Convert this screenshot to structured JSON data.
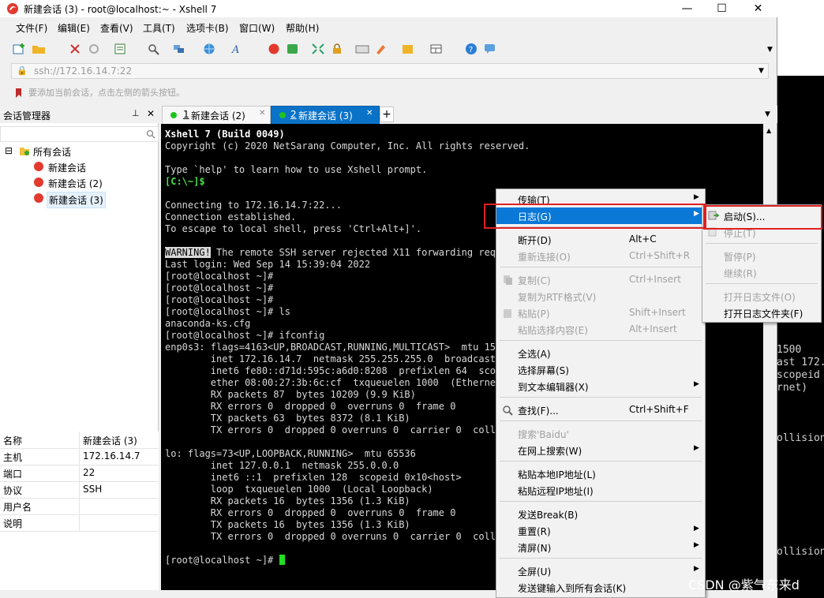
{
  "window": {
    "title": "新建会话 (3) - root@localhost:~ - Xshell 7",
    "controls": [
      "—",
      "☐",
      "✕"
    ]
  },
  "menu": [
    "文件(F)",
    "编辑(E)",
    "查看(V)",
    "工具(T)",
    "选项卡(B)",
    "窗口(W)",
    "帮助(H)"
  ],
  "address": {
    "value": "ssh://172.16.14.7:22"
  },
  "hint": "要添加当前会话，点击左侧的箭头按钮。",
  "session_manager": {
    "title": "会话管理器",
    "pin": "ᵖ",
    "close": "✕",
    "tree": {
      "root": "所有会话",
      "items": [
        "新建会话",
        "新建会话 (2)",
        "新建会话 (3)"
      ]
    },
    "properties": [
      {
        "key": "名称",
        "value": "新建会话 (3)"
      },
      {
        "key": "主机",
        "value": "172.16.14.7"
      },
      {
        "key": "端口",
        "value": "22"
      },
      {
        "key": "协议",
        "value": "SSH"
      },
      {
        "key": "用户名",
        "value": ""
      },
      {
        "key": "说明",
        "value": ""
      }
    ]
  },
  "tabs": [
    {
      "num": "1",
      "label": "新建会话 (2)"
    },
    {
      "num": "2",
      "label": "新建会话 (3)"
    }
  ],
  "terminal": {
    "header1": "Xshell 7 (Build 0049)",
    "header2": "Copyright (c) 2020 NetSarang Computer, Inc. All rights reserved.",
    "help": "Type `help' to learn how to use Xshell prompt.",
    "local_prompt": "[C:\\~]$",
    "connecting": "Connecting to 172.16.14.7:22...",
    "established": "Connection established.",
    "escape": "To escape to local shell, press 'Ctrl+Alt+]'.",
    "warning_tag": "WARNING!",
    "warning_rest": " The remote SSH server rejected X11 forwarding reque",
    "lines": [
      "Last login: Wed Sep 14 15:39:04 2022",
      "[root@localhost ~]#",
      "[root@localhost ~]#",
      "[root@localhost ~]#",
      "[root@localhost ~]# ls",
      "anaconda-ks.cfg",
      "[root@localhost ~]# ifconfig",
      "enp0s3: flags=4163<UP,BROADCAST,RUNNING,MULTICAST>  mtu 1500",
      "        inet 172.16.14.7  netmask 255.255.255.0  broadcast 1",
      "        inet6 fe80::d71d:595c:a6d0:8208  prefixlen 64  scope",
      "        ether 08:00:27:3b:6c:cf  txqueuelen 1000  (Ethernet)",
      "        RX packets 87  bytes 10209 (9.9 KiB)",
      "        RX errors 0  dropped 0  overruns 0  frame 0",
      "        TX packets 63  bytes 8372 (8.1 KiB)",
      "        TX errors 0  dropped 0 overruns 0  carrier 0  collis",
      "",
      "lo: flags=73<UP,LOOPBACK,RUNNING>  mtu 65536",
      "        inet 127.0.0.1  netmask 255.0.0.0",
      "        inet6 ::1  prefixlen 128  scopeid 0x10<host>",
      "        loop  txqueuelen 1000  (Local Loopback)",
      "        RX packets 16  bytes 1356 (1.3 KiB)",
      "        RX errors 0  dropped 0  overruns 0  frame 0",
      "        TX packets 16  bytes 1356 (1.3 KiB)",
      "        TX errors 0  dropped 0 overruns 0  carrier 0  collis",
      ""
    ],
    "final_prompt": "[root@localhost ~]# "
  },
  "context_menu": [
    {
      "label": "传输(T)",
      "shortcut": "",
      "arrow": true,
      "disabled": false
    },
    {
      "label": "日志(G)",
      "shortcut": "",
      "arrow": true,
      "disabled": false,
      "selected": true
    },
    {
      "label": "断开(D)",
      "shortcut": "Alt+C",
      "arrow": false,
      "disabled": false
    },
    {
      "label": "重新连接(O)",
      "shortcut": "Ctrl+Shift+R",
      "arrow": false,
      "disabled": true
    },
    {
      "label": "复制(C)",
      "shortcut": "Ctrl+Insert",
      "arrow": false,
      "disabled": true
    },
    {
      "label": "复制为RTF格式(V)",
      "shortcut": "",
      "arrow": false,
      "disabled": true
    },
    {
      "label": "粘贴(P)",
      "shortcut": "Shift+Insert",
      "arrow": false,
      "disabled": true
    },
    {
      "label": "粘贴选择内容(E)",
      "shortcut": "Alt+Insert",
      "arrow": false,
      "disabled": true
    },
    {
      "label": "全选(A)",
      "shortcut": "",
      "arrow": false,
      "disabled": false
    },
    {
      "label": "选择屏幕(S)",
      "shortcut": "",
      "arrow": false,
      "disabled": false
    },
    {
      "label": "到文本编辑器(X)",
      "shortcut": "",
      "arrow": true,
      "disabled": false
    },
    {
      "label": "查找(F)...",
      "shortcut": "Ctrl+Shift+F",
      "arrow": false,
      "disabled": false
    },
    {
      "label": "搜索'Baidu'",
      "shortcut": "",
      "arrow": false,
      "disabled": true
    },
    {
      "label": "在网上搜索(W)",
      "shortcut": "",
      "arrow": true,
      "disabled": false
    },
    {
      "label": "粘贴本地IP地址(L)",
      "shortcut": "",
      "arrow": false,
      "disabled": false
    },
    {
      "label": "粘贴远程IP地址(I)",
      "shortcut": "",
      "arrow": false,
      "disabled": false
    },
    {
      "label": "发送Break(B)",
      "shortcut": "",
      "arrow": false,
      "disabled": false
    },
    {
      "label": "重置(R)",
      "shortcut": "",
      "arrow": true,
      "disabled": false
    },
    {
      "label": "清屏(N)",
      "shortcut": "",
      "arrow": true,
      "disabled": false
    },
    {
      "label": "全屏(U)",
      "shortcut": "",
      "arrow": true,
      "disabled": false
    },
    {
      "label": "发送键输入到所有会话(K)",
      "shortcut": "",
      "arrow": false,
      "disabled": false
    }
  ],
  "submenu": [
    {
      "label": "启动(S)...",
      "disabled": false
    },
    {
      "label": "停止(T)",
      "disabled": true
    },
    {
      "label": "暂停(P)",
      "disabled": true
    },
    {
      "label": "继续(R)",
      "disabled": true
    },
    {
      "label": "打开日志文件(O)",
      "disabled": true
    },
    {
      "label": "打开日志文件夹(F)",
      "disabled": false
    }
  ],
  "background_terminal": [
    "1500",
    "ast 172.",
    "scopeid",
    "rnet)",
    "ollision",
    "ollision"
  ],
  "watermark": "CSDN @紫气东来d",
  "colors": {
    "accent": "#0a78d7",
    "highlight_box": "#e02020",
    "terminal_bg": "#000000",
    "prompt_green": "#48e048"
  }
}
